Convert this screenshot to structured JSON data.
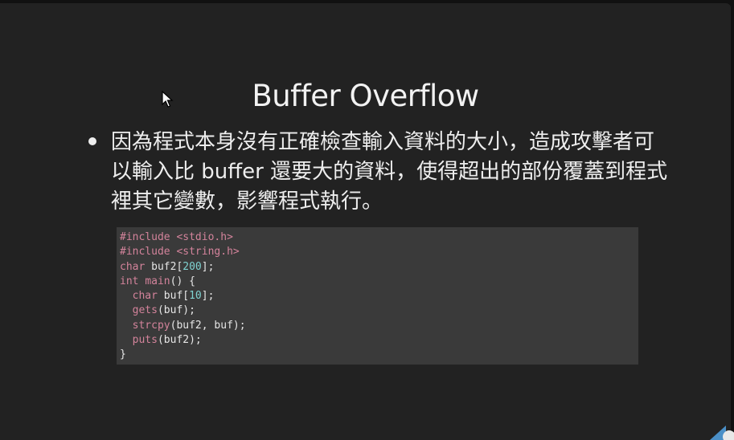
{
  "slide": {
    "title": "Buffer Overflow",
    "bullet": "因為程式本身沒有正確檢查輸入資料的大小，造成攻擊者可以輸入比 buffer 還要大的資料，使得超出的部份覆蓋到程式裡其它變數，影響程式執行。"
  },
  "code": {
    "lines": [
      {
        "a": "#include ",
        "b": "<stdio.h>"
      },
      {
        "a": "#include ",
        "b": "<string.h>"
      },
      {
        "t": "char",
        "r": " buf2[",
        "n": "200",
        "e": "];"
      },
      {
        "t": "int",
        "r": " ",
        "f": "main",
        "e": "() {"
      },
      {
        "t": "  char",
        "r": " buf[",
        "n": "10",
        "e": "];"
      },
      {
        "f": "  gets",
        "e": "(buf);"
      },
      {
        "f": "  strcpy",
        "e": "(buf2, buf);"
      },
      {
        "f": "  puts",
        "e": "(buf2);"
      },
      {
        "e": "}"
      }
    ]
  },
  "colors": {
    "background": "#222222",
    "code_background": "#3a3a3a",
    "keyword": "#d3839b",
    "number": "#7fd3d1",
    "text": "#eeeeee"
  },
  "icons": {
    "pointer": "mouse-pointer-icon",
    "corner": "corner-badge-icon"
  }
}
